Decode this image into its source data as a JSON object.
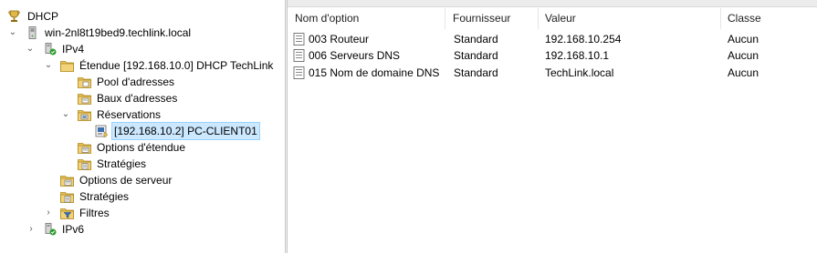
{
  "tree": {
    "root": "DHCP",
    "server": "win-2nl8t19bed9.techlink.local",
    "ipv4": "IPv4",
    "scope": "Étendue [192.168.10.0] DHCP TechLink",
    "pool": "Pool d'adresses",
    "leases": "Baux d'adresses",
    "reservations": "Réservations",
    "reservation_item": "[192.168.10.2] PC-CLIENT01",
    "scope_options": "Options d'étendue",
    "scope_policies": "Stratégies",
    "server_options": "Options de serveur",
    "server_policies": "Stratégies",
    "filters": "Filtres",
    "ipv6": "IPv6"
  },
  "list": {
    "columns": [
      "Nom d'option",
      "Fournisseur",
      "Valeur",
      "Classe"
    ],
    "rows": [
      {
        "name": "003 Routeur",
        "vendor": "Standard",
        "value": "192.168.10.254",
        "class": "Aucun"
      },
      {
        "name": "006 Serveurs DNS",
        "vendor": "Standard",
        "value": "192.168.10.1",
        "class": "Aucun"
      },
      {
        "name": "015 Nom de domaine DNS",
        "vendor": "Standard",
        "value": "TechLink.local",
        "class": "Aucun"
      }
    ]
  },
  "colors": {
    "selection_bg": "#cce8ff",
    "selection_border": "#99d1ff",
    "folder": "#e9c25a"
  }
}
